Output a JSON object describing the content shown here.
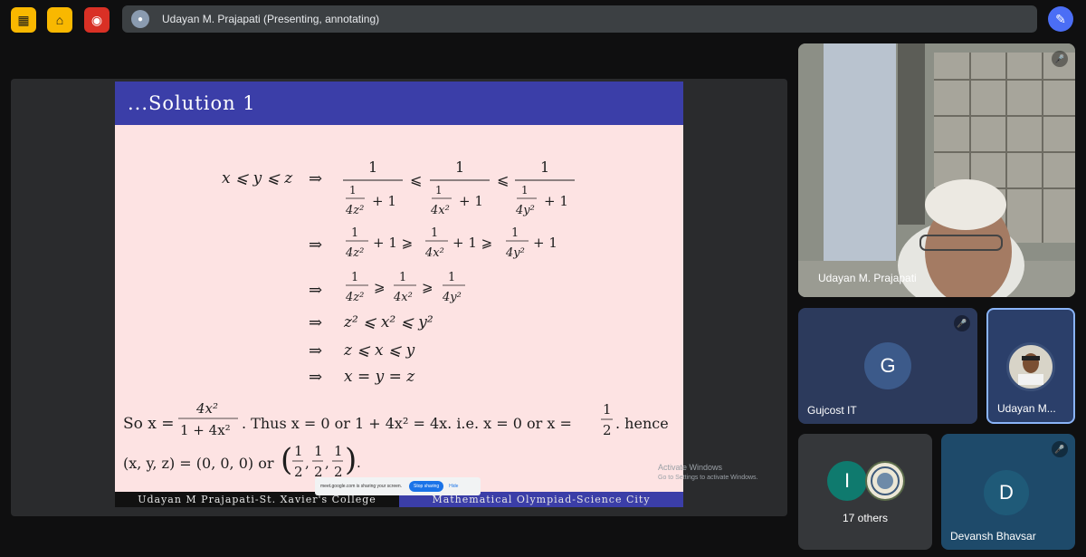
{
  "topbar": {
    "presenter_text": "Udayan M. Prajapati (Presenting, annotating)",
    "btn1_icon": "present-off-icon",
    "btn2_icon": "exit-icon",
    "btn3_icon": "record-icon",
    "annotate_icon": "pen-icon"
  },
  "slide": {
    "title": "...Solution 1",
    "footer_left": "Udayan M Prajapati-St. Xavier's College",
    "footer_right": "Mathematical Olympiad-Science City",
    "lines": {
      "l1_lhs": "x ⩽ y ⩽ z",
      "arrow": "⇒",
      "l4": "z² ⩽ x² ⩽ y²",
      "l5": "z ⩽ x ⩽ y",
      "l6": "x = y = z",
      "so_prefix": "So x =",
      "so_mid": ". Thus x = 0 or 1 + 4x² = 4x. i.e. x = 0 or x =",
      "so_end": ". hence",
      "last": "(x, y, z) = (0, 0, 0) or"
    }
  },
  "share_toast": {
    "text": "meet.google.com is sharing your screen.",
    "stop_label": "Stop sharing",
    "hide_label": "Hide"
  },
  "activate": {
    "title": "Activate Windows",
    "sub": "Go to Settings to activate Windows."
  },
  "participants": {
    "main_name": "Udayan M. Prajapati",
    "gujcost_name": "Gujcost IT",
    "gujcost_initial": "G",
    "udayan_short": "Udayan M...",
    "others_count": "17 others",
    "others_initial": "I",
    "devansh_name": "Devansh Bhavsar",
    "devansh_initial": "D"
  },
  "colors": {
    "slide_header": "#3b3ea8",
    "slide_bg": "#fde3e3",
    "accent_blue": "#4b6ef5",
    "gujcost_avatar": "#3c5a8a",
    "others_avatar": "#0f7a6e",
    "devansh_avatar": "#1f5a78"
  }
}
